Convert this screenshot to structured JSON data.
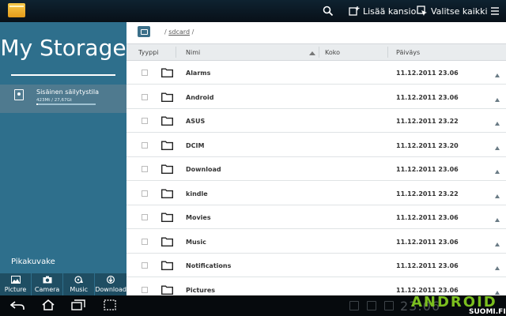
{
  "toolbar": {
    "add_folder_label": "Lisää kansio",
    "select_all_label": "Valitse kaikki"
  },
  "sidebar": {
    "title": "My Storage",
    "storage": {
      "name": "Sisäinen säilytystila",
      "size_text": "423Mt / 27,67Gt",
      "used_fraction": 0.015
    },
    "shortcuts_title": "Pikakuvake",
    "shortcuts": [
      {
        "label": "Picture",
        "icon": "picture-icon"
      },
      {
        "label": "Camera",
        "icon": "camera-icon"
      },
      {
        "label": "Music",
        "icon": "music-icon"
      },
      {
        "label": "Download",
        "icon": "download-icon"
      }
    ]
  },
  "path": {
    "prefix": "/ ",
    "segment": "sdcard",
    "suffix": " /"
  },
  "table": {
    "headers": {
      "type": "Tyyppi",
      "name": "Nimi",
      "size": "Koko",
      "date": "Päiväys"
    },
    "rows": [
      {
        "name": "Alarms",
        "date": "11.12.2011 23.06"
      },
      {
        "name": "Android",
        "date": "11.12.2011 23.06"
      },
      {
        "name": "ASUS",
        "date": "11.12.2011 23.22"
      },
      {
        "name": "DCIM",
        "date": "11.12.2011 23.20"
      },
      {
        "name": "Download",
        "date": "11.12.2011 23.06"
      },
      {
        "name": "kindle",
        "date": "11.12.2011 23.22"
      },
      {
        "name": "Movies",
        "date": "11.12.2011 23.06"
      },
      {
        "name": "Music",
        "date": "11.12.2011 23.06"
      },
      {
        "name": "Notifications",
        "date": "11.12.2011 23.06"
      },
      {
        "name": "Pictures",
        "date": "11.12.2011 23.06"
      }
    ]
  },
  "statusbar": {
    "clock": "23:06"
  },
  "watermark": {
    "brand": "ANDROID",
    "sub": "SUOMI.FI"
  },
  "colors": {
    "sidebar": "#2e6f8c",
    "accent": "#3b6f89",
    "watermark": "#7bbf1f"
  }
}
